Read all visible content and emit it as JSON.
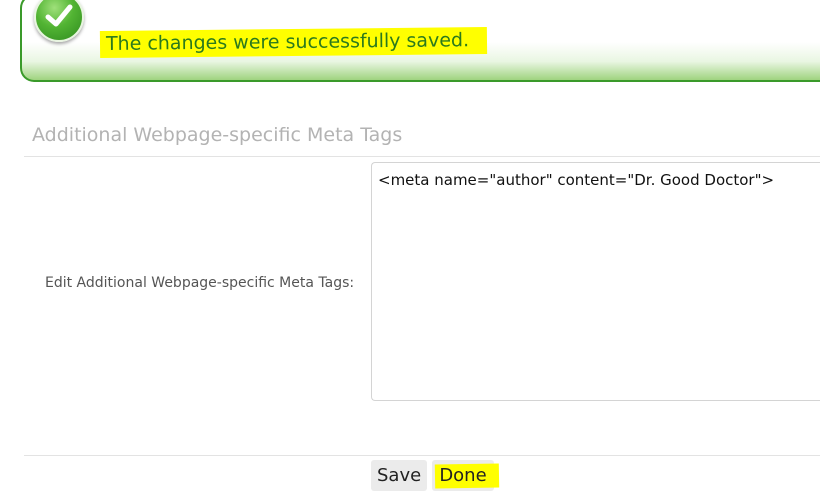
{
  "notification": {
    "message": "The changes were successfully saved.",
    "icon": "checkmark-icon",
    "status_color": "#3a9a2a",
    "highlight_color": "#ffff00"
  },
  "section": {
    "title": "Additional Webpage-specific Meta Tags"
  },
  "form": {
    "field_label": "Edit Additional Webpage-specific Meta Tags:",
    "field_value": "<meta name=\"author\" content=\"Dr. Good Doctor\">"
  },
  "actions": {
    "save_label": "Save",
    "done_label": "Done"
  }
}
